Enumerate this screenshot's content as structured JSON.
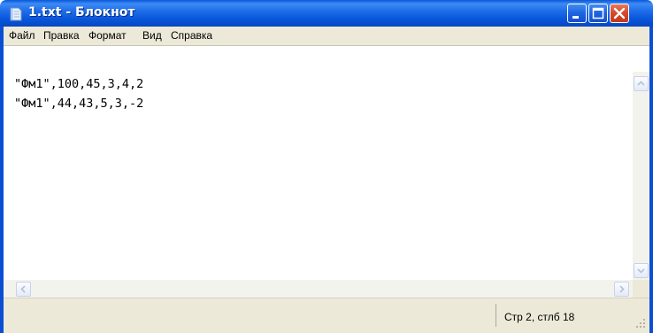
{
  "window": {
    "title": "1.txt - Блокнот",
    "title_icon": "notepad-icon",
    "controls": {
      "minimize": "minimize-icon",
      "maximize": "maximize-icon",
      "close": "close-icon"
    }
  },
  "menu": {
    "items": [
      "Файл",
      "Правка",
      "Формат",
      "Вид",
      "Справка"
    ]
  },
  "editor": {
    "lines": [
      "\"Фм1\",100,45,3,4,2",
      "\"Фм1\",44,43,5,3,-2"
    ]
  },
  "status": {
    "position": "Стр 2, стлб 18"
  },
  "colors": {
    "titlebar": "#0a58d8",
    "close_button": "#d4492a",
    "chrome": "#ece9d8"
  }
}
